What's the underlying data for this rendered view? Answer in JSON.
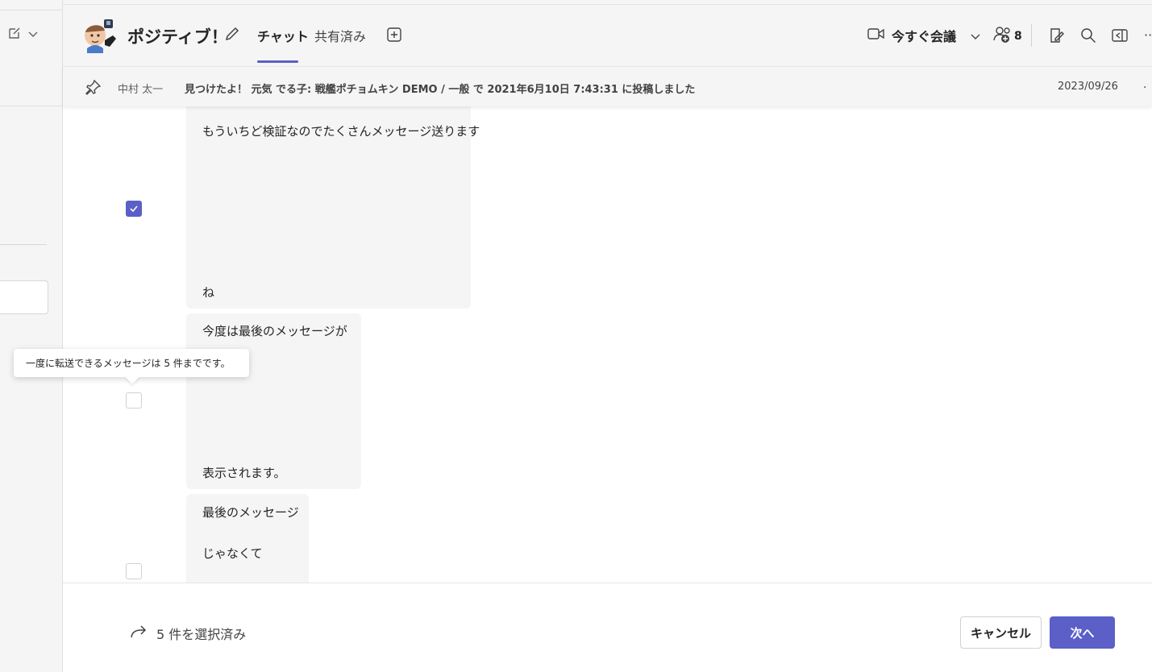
{
  "header": {
    "chat_title": "ポジティブ！",
    "tabs": [
      {
        "label": "チャット",
        "active": true
      },
      {
        "label": "共有済み",
        "active": false
      }
    ],
    "meet_label": "今すぐ会議",
    "participant_count": "8"
  },
  "pinned": {
    "author": "中村 太一",
    "text": "見つけたよ！ 元気 でる子: 戦艦ポチョムキン DEMO / 一般 で 2021年6月10日 7:43:31 に投稿しました",
    "date": "2023/09/26",
    "more": "·"
  },
  "messages": [
    {
      "lines": [
        "もういちど検証なのでたくさんメッセージ送ります",
        "ね"
      ],
      "checked": true
    },
    {
      "lines": [
        "今度は最後のメッセージが",
        "表示されます。"
      ],
      "checked": false
    },
    {
      "lines": [
        "最後のメッセージ",
        "じゃなくて"
      ],
      "checked": false
    }
  ],
  "tooltip": "一度に転送できるメッセージは 5 件までです。",
  "footer": {
    "selected_text": "5 件を選択済み",
    "cancel_label": "キャンセル",
    "next_label": "次へ"
  },
  "colors": {
    "accent": "#5b5fc7",
    "bubble": "#f5f5f5",
    "background": "#ffffff"
  }
}
